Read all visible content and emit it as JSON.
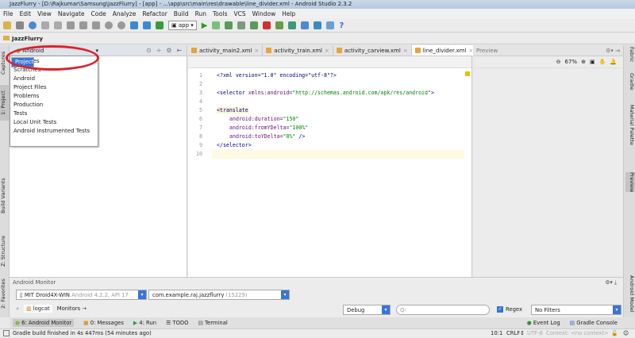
{
  "window": {
    "title": "JazzFlurry - [D:\\Rajkumar\\Samsung\\JazzFlurry] - [app] - ...\\app\\src\\main\\res\\drawable\\line_divider.xml - Android Studio 2.3.2"
  },
  "menu": [
    "File",
    "Edit",
    "View",
    "Navigate",
    "Code",
    "Analyze",
    "Refactor",
    "Build",
    "Run",
    "Tools",
    "VCS",
    "Window",
    "Help"
  ],
  "toolbar": {
    "run_config": "app"
  },
  "breadcrumb": "JazzFlurry",
  "left_tabs": {
    "captures": "Captures",
    "project": "1: Project",
    "build_variants": "Build Variants",
    "structure": "Z: Structure",
    "favorites": "2: Favorites"
  },
  "project_panel": {
    "view_selector": "Android",
    "options": [
      "Project",
      "Packages",
      "Scratches",
      "Android",
      "Project Files",
      "Problems",
      "Production",
      "Tests",
      "Local Unit Tests",
      "Android Instrumented Tests"
    ]
  },
  "editor": {
    "tabs": [
      "activity_main2.xml",
      "activity_train.xml",
      "activity_carview.xml",
      "line_divider.xml"
    ],
    "active_tab": 3,
    "lines": [
      "1",
      "2",
      "3",
      "4",
      "5",
      "6",
      "7",
      "8",
      "9",
      "10"
    ],
    "code": {
      "l1": "<?xml version=\"1.0\" encoding=\"utf-8\"?>",
      "l3_tag": "<selector ",
      "l3_attr": "xmlns:android=",
      "l3_val": "\"http://schemas.android.com/apk/res/android\"",
      "l3_end": ">",
      "l5": "<translate",
      "l6_attr": "android:duration=",
      "l6_val": "\"150\"",
      "l7_attr": "android:fromYDelta=",
      "l7_val": "\"100%\"",
      "l8_attr": "android:toYDelta=",
      "l8_val": "\"0%\"",
      "l8_end": " />",
      "l9": "</selector>"
    }
  },
  "preview": {
    "title": "Preview",
    "zoom": "67%"
  },
  "right_tabs": {
    "fabric": "Fabric",
    "gradle": "Gradle",
    "material": "Material Palette",
    "preview": "Preview",
    "android_model": "Android Model"
  },
  "monitor": {
    "title": "Android Monitor",
    "device": "MIT Droid4X-WIN",
    "device_info": "Android 4.2.2, API 17",
    "process": "com.example.raj.jazzflurry",
    "pid": "(15229)",
    "tab_logcat": "logcat",
    "tab_monitors": "Monitors",
    "log_level": "Debug",
    "search_placeholder": "Q-",
    "regex_label": "Regex",
    "filter": "No Filters"
  },
  "toolwindows": {
    "android_monitor": "6: Android Monitor",
    "messages": "0: Messages",
    "run": "4: Run",
    "todo": "TODO",
    "terminal": "Terminal",
    "event_log": "Event Log",
    "gradle_console": "Gradle Console"
  },
  "status": {
    "message": "Gradle build finished in 4s 447ms (54 minutes ago)",
    "position": "10:1",
    "line_sep": "CRLF↕",
    "encoding": "UTF-8",
    "context": "Context: <no context>"
  }
}
